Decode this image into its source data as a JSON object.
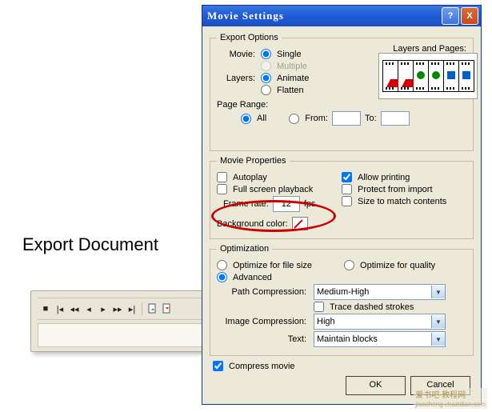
{
  "annotation": "Export Document",
  "toolbar": {
    "icons": [
      "stop",
      "first",
      "prev",
      "play-prev",
      "play",
      "next",
      "last",
      "doc-import",
      "doc-export"
    ]
  },
  "dialog": {
    "title": "Movie Settings",
    "close_label": "X",
    "help_label": "?"
  },
  "exportOptions": {
    "legend": "Export Options",
    "layers_and_pages": "Layers and Pages:",
    "movie_label": "Movie:",
    "movie_single": "Single",
    "movie_multiple": "Multiple",
    "layers_label": "Layers:",
    "layers_animate": "Animate",
    "layers_flatten": "Flatten",
    "page_range": "Page Range:",
    "all": "All",
    "from": "From:",
    "to": "To:"
  },
  "movieProperties": {
    "legend": "Movie Properties",
    "autoplay": "Autoplay",
    "full_screen": "Full screen playback",
    "allow_printing": "Allow printing",
    "protect": "Protect from import",
    "size_match": "Size to match contents",
    "frame_rate_label": "Frame rate:",
    "frame_rate_value": "12",
    "fps": "fps",
    "bg_color": "Background color:"
  },
  "optimization": {
    "legend": "Optimization",
    "opt_size": "Optimize for file size",
    "opt_quality": "Optimize for quality",
    "advanced": "Advanced",
    "path_comp_label": "Path Compression:",
    "path_comp_value": "Medium-High",
    "trace_dashed": "Trace dashed strokes",
    "image_comp_label": "Image Compression:",
    "image_comp_value": "High",
    "text_label": "Text:",
    "text_value": "Maintain blocks"
  },
  "compress_movie": "Compress movie",
  "buttons": {
    "ok": "OK",
    "cancel": "Cancel"
  },
  "watermark": {
    "main": "爱书吧 教程网",
    "sub": "jiaocheng.chazidian.com"
  }
}
